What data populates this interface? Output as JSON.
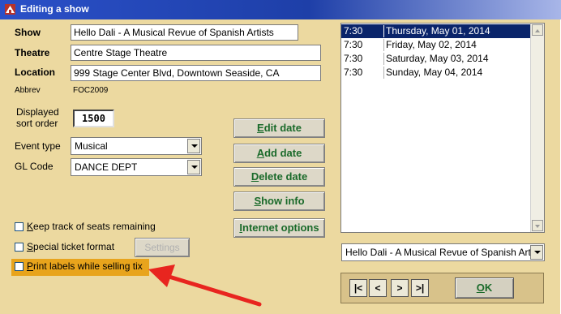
{
  "window": {
    "title": "Editing a show"
  },
  "fields": {
    "show_label": "Show",
    "show_value": "Hello Dali - A Musical Revue of Spanish Artists",
    "theatre_label": "Theatre",
    "theatre_value": "Centre Stage Theatre",
    "location_label": "Location",
    "location_value": "999 Stage Center Blvd, Downtown Seaside, CA",
    "abbrev_label": "Abbrev",
    "abbrev_value": "FOC2009",
    "sort_label_line1": "Displayed",
    "sort_label_line2": "sort order",
    "sort_value": "1500",
    "event_type_label": "Event type",
    "event_type_value": "Musical",
    "gl_code_label": "GL Code",
    "gl_code_value": "DANCE DEPT"
  },
  "buttons": {
    "edit_date_u": "E",
    "edit_date_rest": "dit date",
    "add_date_u": "A",
    "add_date_rest": "dd date",
    "delete_date_u": "D",
    "delete_date_rest": "elete date",
    "show_info_u": "S",
    "show_info_rest": "how info",
    "internet_options_u": "I",
    "internet_options_rest": "nternet options",
    "settings": "Settings",
    "ok_u": "O",
    "ok_rest": "K"
  },
  "checkboxes": {
    "keep_track_u": "K",
    "keep_track_rest": "eep track of seats remaining",
    "special_ticket_u": "S",
    "special_ticket_rest": "pecial ticket format",
    "print_labels_u": "P",
    "print_labels_rest": "rint labels while selling tix"
  },
  "dates": [
    {
      "time": "7:30",
      "date": "Thursday, May 01, 2014"
    },
    {
      "time": "7:30",
      "date": "Friday, May 02, 2014"
    },
    {
      "time": "7:30",
      "date": "Saturday, May 03, 2014"
    },
    {
      "time": "7:30",
      "date": "Sunday, May 04, 2014"
    }
  ],
  "show_selector_value": "Hello Dali - A Musical Revue of Spanish Artists",
  "nav": {
    "first": "|<",
    "prev": "<",
    "next": ">",
    "last": ">|"
  },
  "colors": {
    "highlight": "#e8a41c",
    "annotation_arrow": "#e8251f",
    "button_text": "#1a6a2a",
    "selection": "#0a246a"
  }
}
